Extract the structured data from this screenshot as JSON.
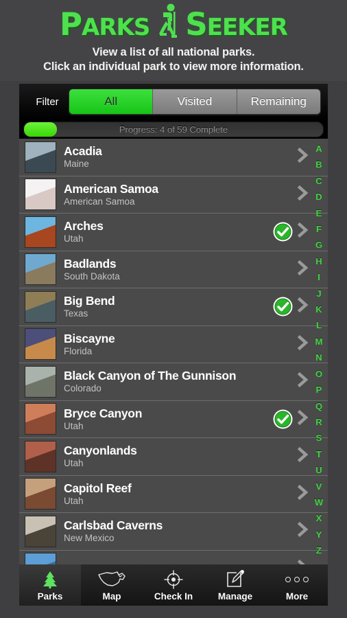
{
  "header": {
    "logo_part1": "P",
    "logo_part1_rest": "ARKS",
    "logo_icon": "hiker-icon",
    "logo_part2": "S",
    "logo_part2_rest": "EEKER",
    "subtitle_line1": "View a list of all national parks.",
    "subtitle_line2": "Click an individual park to view more information.",
    "logo_color": "#4ee14e"
  },
  "filter": {
    "label": "Filter",
    "options": [
      {
        "label": "All",
        "selected": true
      },
      {
        "label": "Visited",
        "selected": false
      },
      {
        "label": "Remaining",
        "selected": false
      }
    ]
  },
  "progress": {
    "text": "Progress: 4 of 59 Complete",
    "visited": 4,
    "total": 59,
    "percent": 11,
    "fill_color": "#38d606"
  },
  "list": {
    "chevron_icon": "chevron-right-icon",
    "visited_icon": "check-circle-icon",
    "rows": [
      {
        "name": "Acadia",
        "state": "Maine",
        "visited": false,
        "thumb_color_a": "#9fb2bd",
        "thumb_color_b": "#3b4a52"
      },
      {
        "name": "American Samoa",
        "state": "American Samoa",
        "visited": false,
        "thumb_color_a": "#f4f2f2",
        "thumb_color_b": "#d8c9c5"
      },
      {
        "name": "Arches",
        "state": "Utah",
        "visited": true,
        "thumb_color_a": "#6cb6e0",
        "thumb_color_b": "#a8461f"
      },
      {
        "name": "Badlands",
        "state": "South Dakota",
        "visited": false,
        "thumb_color_a": "#6fa9cf",
        "thumb_color_b": "#8a7a5e"
      },
      {
        "name": "Big Bend",
        "state": "Texas",
        "visited": true,
        "thumb_color_a": "#8f7e55",
        "thumb_color_b": "#4a5d63"
      },
      {
        "name": "Biscayne",
        "state": "Florida",
        "visited": false,
        "thumb_color_a": "#4b4f7a",
        "thumb_color_b": "#c88a4a"
      },
      {
        "name": "Black Canyon of The Gunnison",
        "state": "Colorado",
        "visited": false,
        "thumb_color_a": "#a9b3ab",
        "thumb_color_b": "#6e7468"
      },
      {
        "name": "Bryce Canyon",
        "state": "Utah",
        "visited": true,
        "thumb_color_a": "#cf7e5a",
        "thumb_color_b": "#8d4a34"
      },
      {
        "name": "Canyonlands",
        "state": "Utah",
        "visited": false,
        "thumb_color_a": "#b0604a",
        "thumb_color_b": "#5f3228"
      },
      {
        "name": "Capitol Reef",
        "state": "Utah",
        "visited": false,
        "thumb_color_a": "#c5a07c",
        "thumb_color_b": "#7a4a33"
      },
      {
        "name": "Carlsbad Caverns",
        "state": "New Mexico",
        "visited": false,
        "thumb_color_a": "#c9c2b4",
        "thumb_color_b": "#4a4338"
      },
      {
        "name": "",
        "state": "",
        "visited": false,
        "thumb_color_a": "#5d9ed6",
        "thumb_color_b": "#3a6e9e"
      }
    ]
  },
  "alphabet": [
    "A",
    "B",
    "C",
    "D",
    "E",
    "F",
    "G",
    "H",
    "I",
    "J",
    "K",
    "L",
    "M",
    "N",
    "O",
    "P",
    "Q",
    "R",
    "S",
    "T",
    "U",
    "V",
    "W",
    "X",
    "Y",
    "Z"
  ],
  "tabbar": {
    "tabs": [
      {
        "label": "Parks",
        "icon": "tree-icon",
        "active": true
      },
      {
        "label": "Map",
        "icon": "us-map-icon",
        "active": false
      },
      {
        "label": "Check In",
        "icon": "target-crosshair-icon",
        "active": false
      },
      {
        "label": "Manage",
        "icon": "edit-pencil-icon",
        "active": false
      },
      {
        "label": "More",
        "icon": "three-dots-icon",
        "active": false
      }
    ]
  }
}
